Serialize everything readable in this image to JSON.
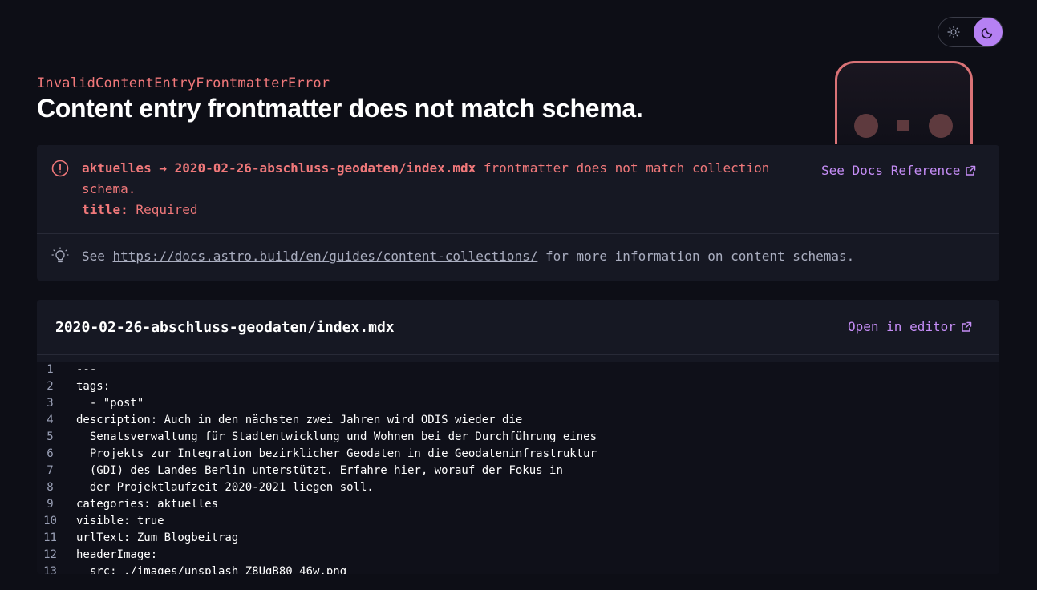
{
  "theme_toggle": {
    "light_icon": "sun-icon",
    "dark_icon": "moon-icon",
    "active": "dark"
  },
  "error": {
    "name": "InvalidContentEntryFrontmatterError",
    "title": "Content entry frontmatter does not match schema."
  },
  "message": {
    "entry_path": "aktuelles → 2020-02-26-abschluss-geodaten/index.mdx",
    "text": " frontmatter does not match collection schema.",
    "field_name": "title:",
    "field_error": " Required",
    "docs_link_label": "See Docs Reference"
  },
  "hint": {
    "prefix": "See ",
    "link": "https://docs.astro.build/en/guides/content-collections/",
    "suffix": " for more information on content schemas."
  },
  "code": {
    "file_name": "2020-02-26-abschluss-geodaten/index.mdx",
    "open_editor_label": "Open in editor",
    "lines": [
      {
        "n": "1",
        "text": "---"
      },
      {
        "n": "2",
        "text": "tags:"
      },
      {
        "n": "3",
        "text": "  - \"post\""
      },
      {
        "n": "4",
        "text": "description: Auch in den nächsten zwei Jahren wird ODIS wieder die"
      },
      {
        "n": "5",
        "text": "  Senatsverwaltung für Stadtentwicklung und Wohnen bei der Durchführung eines"
      },
      {
        "n": "6",
        "text": "  Projekts zur Integration bezirklicher Geodaten in die Geodateninfrastruktur"
      },
      {
        "n": "7",
        "text": "  (GDI) des Landes Berlin unterstützt. Erfahre hier, worauf der Fokus in"
      },
      {
        "n": "8",
        "text": "  der Projektlaufzeit 2020-2021 liegen soll."
      },
      {
        "n": "9",
        "text": "categories: aktuelles"
      },
      {
        "n": "10",
        "text": "visible: true"
      },
      {
        "n": "11",
        "text": "urlText: Zum Blogbeitrag"
      },
      {
        "n": "12",
        "text": "headerImage:"
      },
      {
        "n": "13",
        "text": "  src: ./images/unsplash_Z8UgB80_46w.png"
      }
    ]
  },
  "colors": {
    "background": "#0d0e16",
    "card": "#161823",
    "error": "#f0787a",
    "accent": "#c58df6",
    "toggle_active": "#b681f3"
  }
}
